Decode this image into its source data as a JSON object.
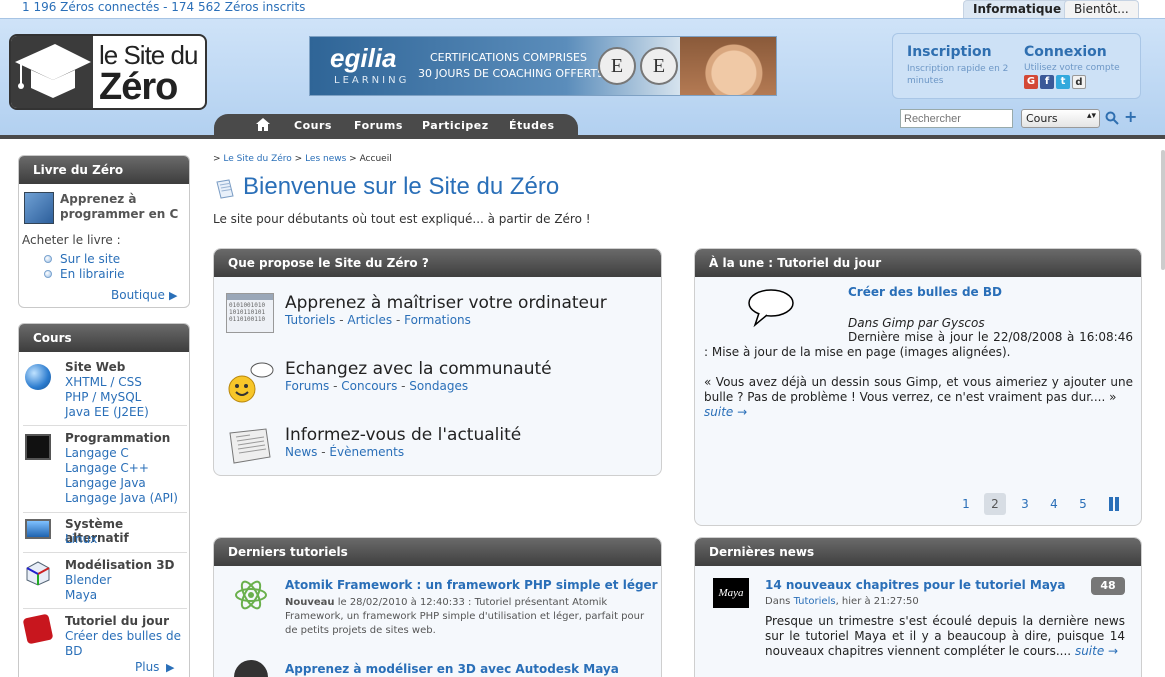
{
  "top": {
    "stats": "1 196 Zéros connectés - 174 562 Zéros inscrits",
    "tab_active": "Informatique",
    "tab_other": "Bientôt..."
  },
  "header": {
    "logo_line1": "le Site du",
    "logo_line2": "Zéro",
    "banner": {
      "brand": "egilia",
      "sub": "LEARNING",
      "line1": "CERTIFICATIONS COMPRISES",
      "line2": "30 JOURS DE COACHING OFFERTS",
      "seal1": "E",
      "seal2": "E"
    },
    "inscription_title": "Inscription",
    "inscription_sub": "Inscription rapide en 2 minutes",
    "connexion_title": "Connexion",
    "connexion_sub": "Utilisez votre compte",
    "social": [
      "G",
      "f",
      "t",
      "d"
    ],
    "nav": [
      "Cours",
      "Forums",
      "Participez",
      "Études"
    ],
    "search_placeholder": "Rechercher",
    "search_select": "Cours",
    "plus": "+"
  },
  "sidebar": {
    "livre": {
      "title": "Livre du Zéro",
      "book_text_1": "Apprenez à",
      "book_text_2": "programmer en C",
      "acheter": "Acheter le livre :",
      "links": [
        "Sur le site",
        "En librairie"
      ],
      "more": "Boutique"
    },
    "cours": {
      "title": "Cours",
      "categories": [
        {
          "title": "Site Web",
          "links": [
            "XHTML / CSS",
            "PHP / MySQL",
            "Java EE (J2EE)"
          ]
        },
        {
          "title": "Programmation",
          "links": [
            "Langage C",
            "Langage C++",
            "Langage Java",
            "Langage Java (API)"
          ]
        },
        {
          "title": "Système alternatif",
          "links": [
            "Linux"
          ]
        },
        {
          "title": "Modélisation 3D",
          "links": [
            "Blender",
            "Maya"
          ]
        },
        {
          "title": "Tutoriel du jour",
          "links": [
            "Créer des bulles de",
            "BD"
          ]
        }
      ],
      "more": "Plus"
    }
  },
  "main": {
    "breadcrumb": [
      "Le Site du Zéro",
      "Les news",
      "Accueil"
    ],
    "title": "Bienvenue sur le Site du Zéro",
    "tagline": "Le site pour débutants où tout est expliqué... à partir de Zéro !",
    "propose": {
      "title": "Que propose le Site du Zéro ?",
      "items": [
        {
          "title": "Apprenez à maîtriser votre ordinateur",
          "links": [
            "Tutoriels",
            "Articles",
            "Formations"
          ]
        },
        {
          "title": "Echangez avec la communauté",
          "links": [
            "Forums",
            "Concours",
            "Sondages"
          ]
        },
        {
          "title": "Informez-vous de l'actualité",
          "links": [
            "News",
            "Évènements"
          ]
        }
      ]
    },
    "une": {
      "title": "À la une : Tutoriel du jour",
      "tuto_title": "Créer des bulles de BD",
      "author": "Dans Gimp par Gyscos",
      "update": "Dernière mise à jour le 22/08/2008 à 16:08:46 : Mise à jour de la mise en page (images alignées).",
      "excerpt": "« Vous avez déjà un dessin sous Gimp, et vous aimeriez y ajouter une bulle ? Pas de problème ! Vous verrez, ce n'est vraiment pas dur.... »",
      "suite": "suite →",
      "pages": [
        "1",
        "2",
        "3",
        "4",
        "5"
      ],
      "active_page": "2"
    },
    "tutos": {
      "title": "Derniers tutoriels",
      "items": [
        {
          "title": "Atomik Framework : un framework PHP simple et léger",
          "status": "Nouveau",
          "meta": " le 28/02/2010 à 12:40:33 : Tutoriel présentant Atomik Framework, un framework PHP simple d'utilisation et léger, parfait pour de petits projets de sites web."
        },
        {
          "title": "Apprenez à modéliser en 3D avec Autodesk Maya",
          "status": "",
          "meta": ""
        }
      ]
    },
    "news": {
      "title": "Dernières news",
      "item_title": "14 nouveaux chapitres pour le tutoriel Maya",
      "meta_prefix": "Dans ",
      "meta_link": "Tutoriels",
      "meta_suffix": ", hier à 21:27:50",
      "count": "48",
      "logo": "Maya",
      "text": "Presque un trimestre s'est écoulé depuis la dernière news sur le tutoriel Maya et il y a beaucoup à dire, puisque 14 nouveaux chapitres viennent compléter le cours....",
      "suite": "suite →"
    }
  }
}
